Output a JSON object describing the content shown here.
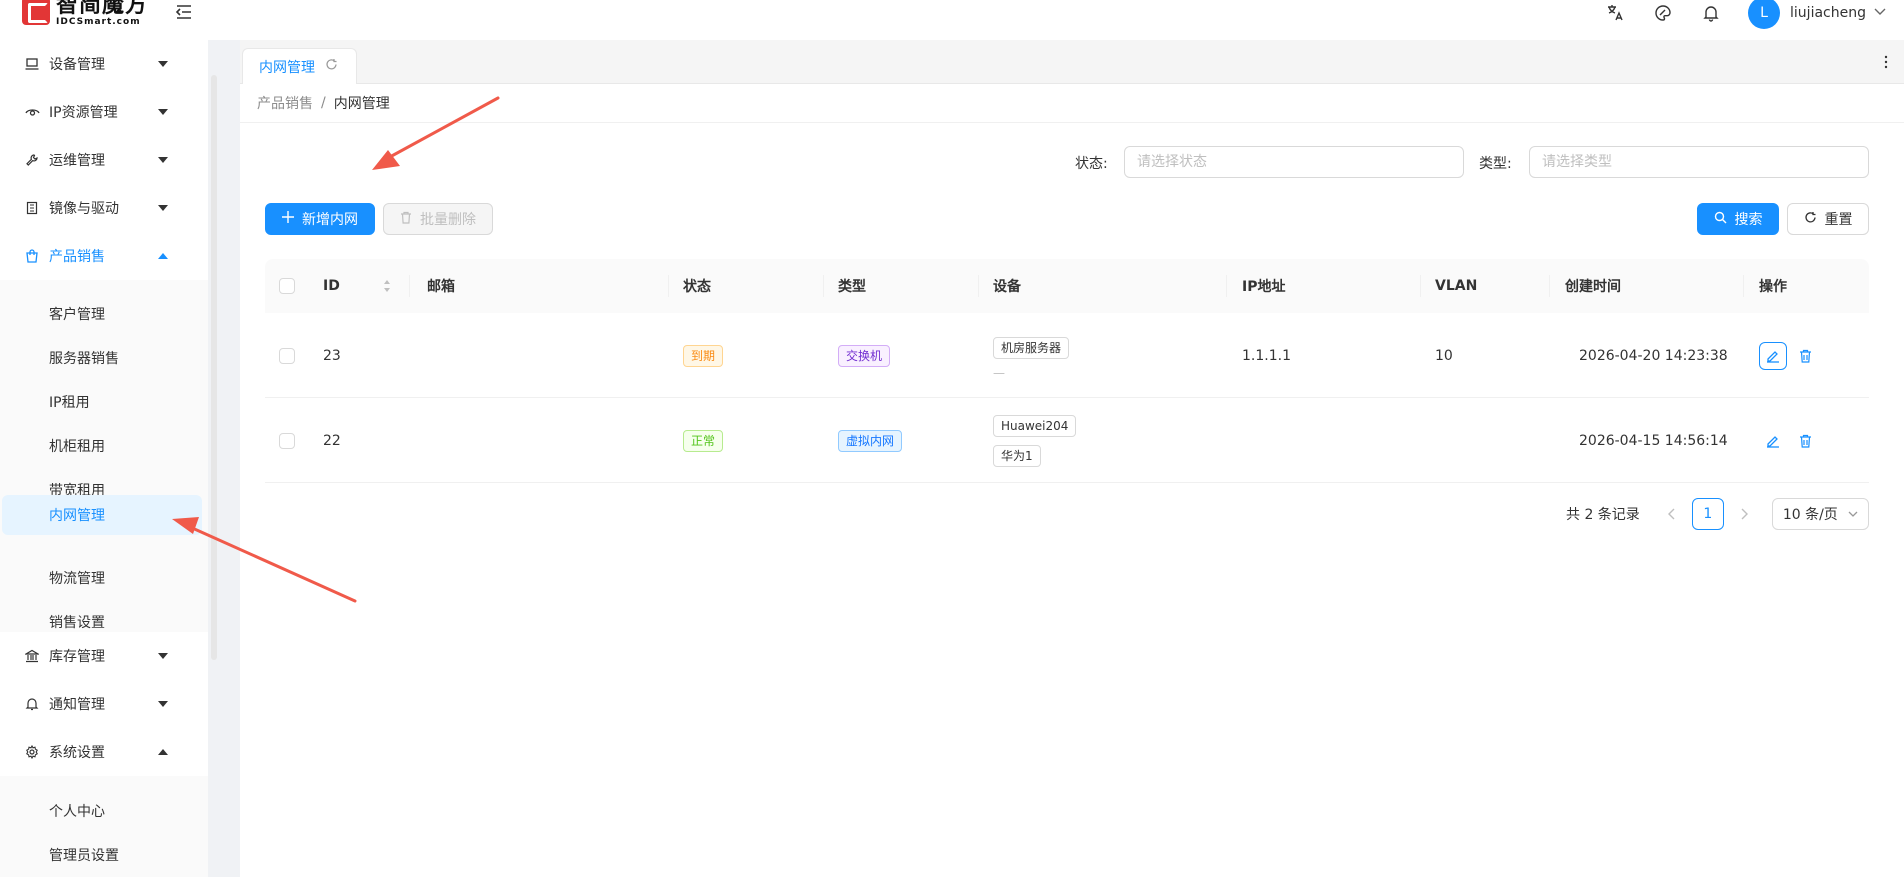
{
  "header": {
    "logo_cn": "智简魔方",
    "logo_en": "IDCSmart.com",
    "avatar_letter": "L",
    "username": "liujiacheng"
  },
  "sidebar": {
    "items": [
      {
        "label": "设备管理",
        "icon": "laptop-icon"
      },
      {
        "label": "IP资源管理",
        "icon": "eye-icon"
      },
      {
        "label": "运维管理",
        "icon": "wrench-icon"
      },
      {
        "label": "镜像与驱动",
        "icon": "book-icon"
      },
      {
        "label": "产品销售",
        "icon": "shopping-bag-icon"
      },
      {
        "label": "库存管理",
        "icon": "bank-icon"
      },
      {
        "label": "通知管理",
        "icon": "bell-icon"
      },
      {
        "label": "系统设置",
        "icon": "gear-icon"
      }
    ],
    "product_sub": [
      "客户管理",
      "服务器销售",
      "IP租用",
      "机柜租用",
      "带宽租用",
      "内网管理",
      "物流管理",
      "销售设置"
    ],
    "system_sub": [
      "个人中心",
      "管理员设置"
    ]
  },
  "tabs": [
    {
      "label": "内网管理"
    }
  ],
  "breadcrumb": {
    "parent": "产品销售",
    "separator": "/",
    "current": "内网管理"
  },
  "filters": {
    "status_label": "状态:",
    "status_placeholder": "请选择状态",
    "type_label": "类型:",
    "type_placeholder": "请选择类型"
  },
  "toolbar": {
    "add_label": "新增内网",
    "batch_delete_label": "批量删除",
    "search_label": "搜索",
    "reset_label": "重置"
  },
  "table": {
    "columns": [
      "ID",
      "邮箱",
      "状态",
      "类型",
      "设备",
      "IP地址",
      "VLAN",
      "创建时间",
      "操作"
    ],
    "rows": [
      {
        "id": "23",
        "email": "",
        "status": "到期",
        "type": "交换机",
        "devices": [
          "机房服务器"
        ],
        "device_dash": "—",
        "ip": "1.1.1.1",
        "vlan": "10",
        "created": "2026-04-20 14:23:38"
      },
      {
        "id": "22",
        "email": "",
        "status": "正常",
        "type": "虚拟内网",
        "devices": [
          "Huawei204",
          "华为1"
        ],
        "ip": "",
        "vlan": "",
        "created": "2026-04-15 14:56:14"
      }
    ]
  },
  "pagination": {
    "total_text": "共 2 条记录",
    "current_page": "1",
    "page_size": "10 条/页"
  },
  "colors": {
    "accent": "#1890ff",
    "annotation": "#f05a4a"
  }
}
